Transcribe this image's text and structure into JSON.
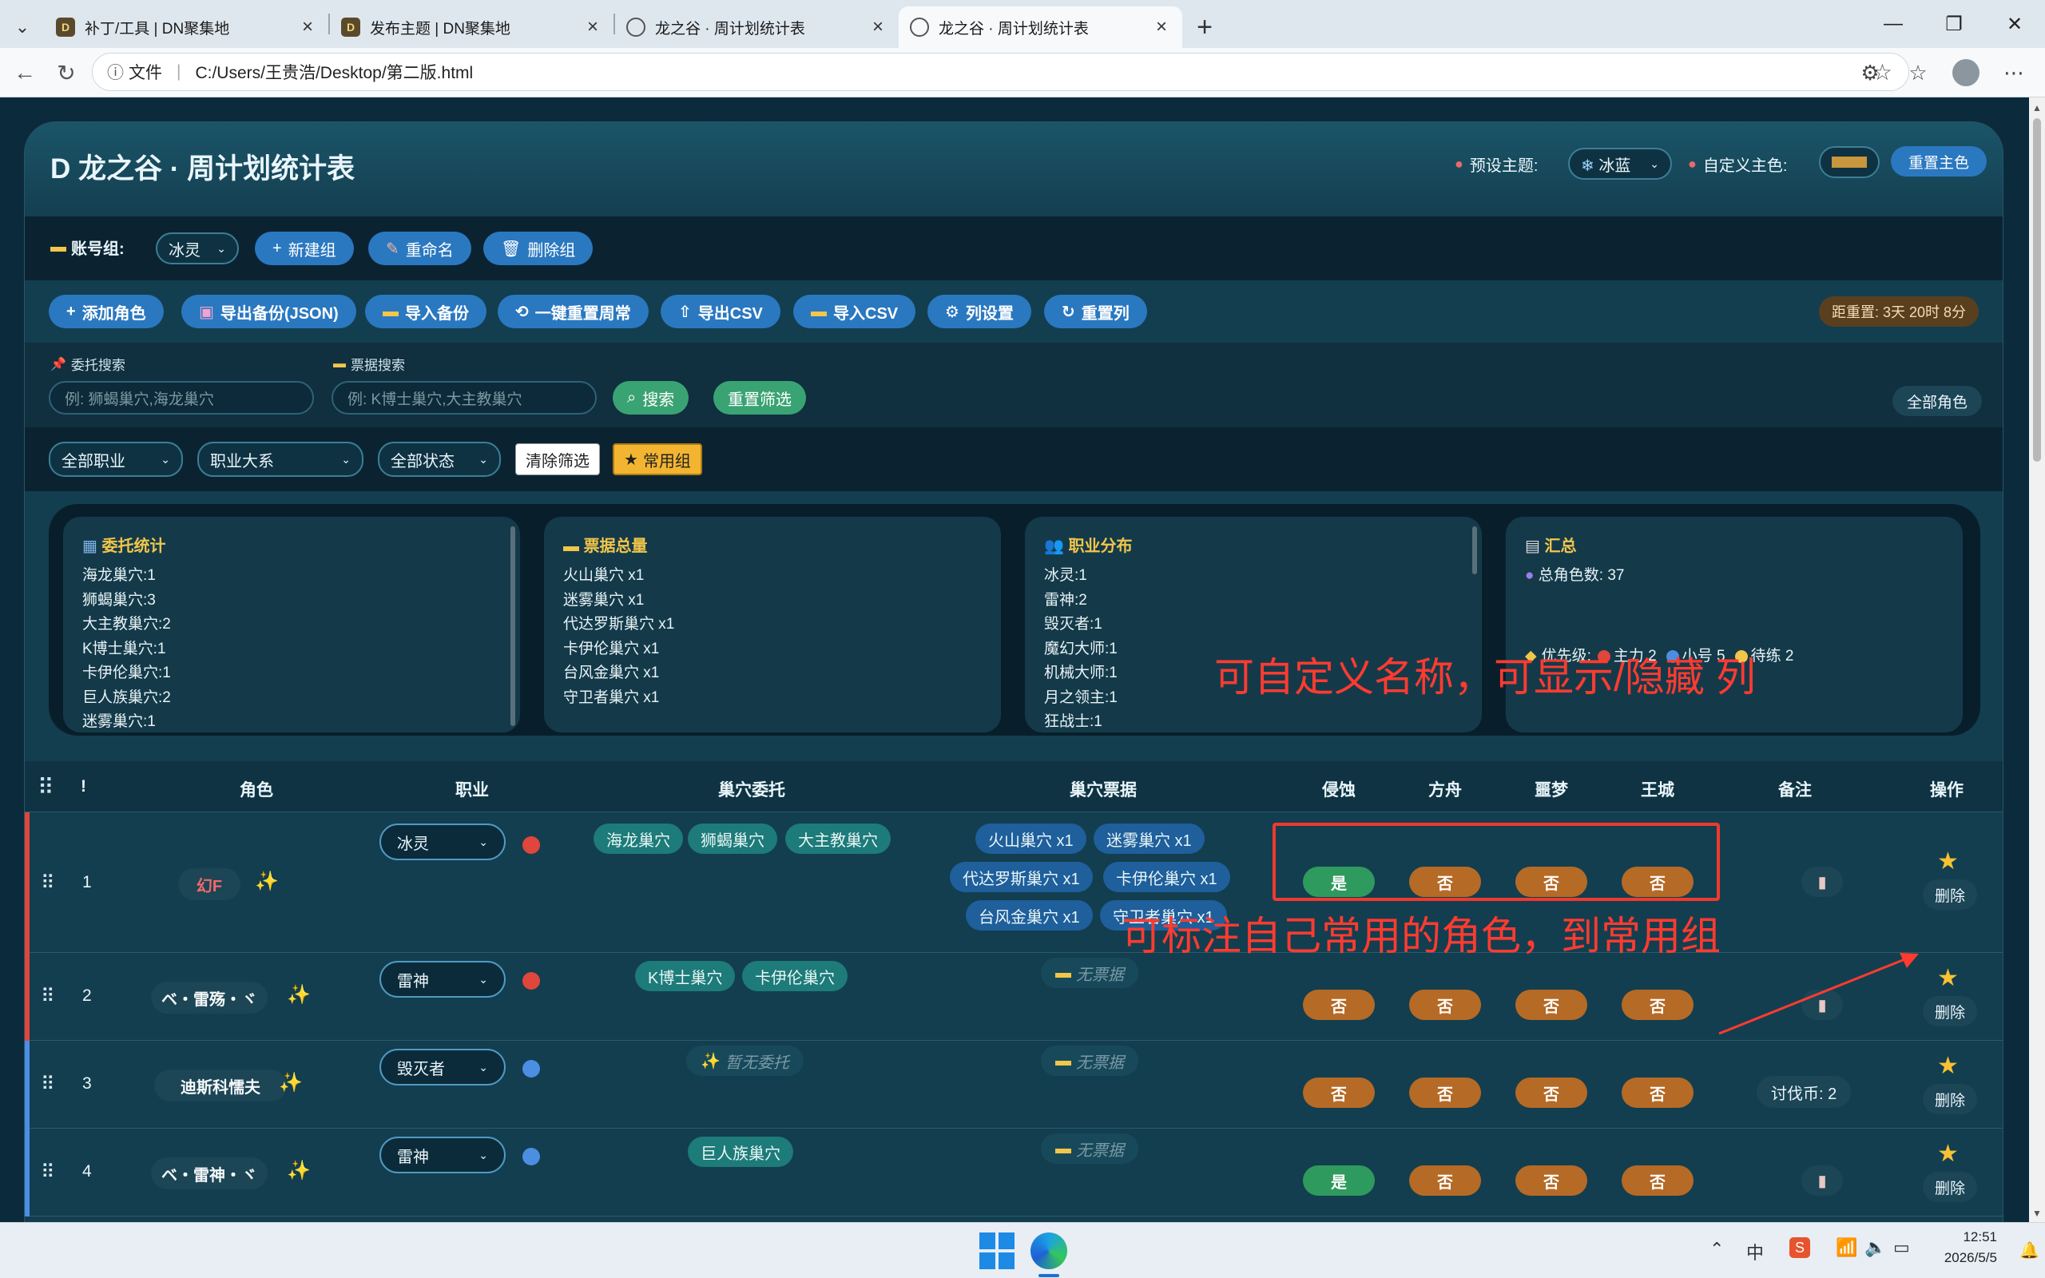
{
  "browser": {
    "tabs": [
      {
        "title": "补丁/工具 | DN聚集地",
        "favicon": "dn-logo-icon",
        "active": false
      },
      {
        "title": "发布主题 | DN聚集地",
        "favicon": "dn-logo-icon",
        "active": false
      },
      {
        "title": "龙之谷 · 周计划统计表",
        "favicon": "globe-icon",
        "active": false
      },
      {
        "title": "龙之谷 · 周计划统计表",
        "favicon": "globe-icon",
        "active": true
      }
    ],
    "address": {
      "info": "文件",
      "url": "C:/Users/王贵浩/Desktop/第二版.html"
    }
  },
  "header": {
    "title": "D 龙之谷 · 周计划统计表",
    "preset_theme_label": "预设主题:",
    "preset_theme_value": "冰蓝",
    "custom_color_label": "自定义主色:",
    "custom_color": "#c8963c",
    "reset_color": "重置主色"
  },
  "groupbar": {
    "label": "账号组:",
    "selected": "冰灵",
    "new": "新建组",
    "rename": "重命名",
    "delete": "删除组"
  },
  "actions": {
    "add_role": "添加角色",
    "export_json": "导出备份(JSON)",
    "import_backup": "导入备份",
    "reset_weekly": "一键重置周常",
    "export_csv": "导出CSV",
    "import_csv": "导入CSV",
    "col_settings": "列设置",
    "reset_cols": "重置列",
    "countdown": "距重置: 3天 20时 8分"
  },
  "search": {
    "commission_label": "委托搜索",
    "commission_placeholder": "例: 狮蝎巢穴,海龙巢穴",
    "ticket_label": "票据搜索",
    "ticket_placeholder": "例: K博士巢穴,大主教巢穴",
    "search_btn": "搜索",
    "reset_btn": "重置筛选",
    "all_roles": "全部角色"
  },
  "filters": {
    "job": "全部职业",
    "job_class": "职业大系",
    "status": "全部状态",
    "clear": "清除筛选",
    "favorites": "常用组"
  },
  "stats": {
    "commission": {
      "title": "委托统计",
      "lines": [
        "海龙巢穴:1",
        "狮蝎巢穴:3",
        "大主教巢穴:2",
        "K博士巢穴:1",
        "卡伊伦巢穴:1",
        "巨人族巢穴:2",
        "迷雾巢穴:1"
      ]
    },
    "tickets": {
      "title": "票据总量",
      "lines": [
        "火山巢穴 x1",
        "迷雾巢穴 x1",
        "代达罗斯巢穴 x1",
        "卡伊伦巢穴 x1",
        "台风金巢穴 x1",
        "守卫者巢穴 x1"
      ]
    },
    "jobs": {
      "title": "职业分布",
      "lines": [
        "冰灵:1",
        "雷神:2",
        "毁灭者:1",
        "魔幻大师:1",
        "机械大师:1",
        "月之领主:1",
        "狂战士:1"
      ]
    },
    "summary": {
      "title": "汇总",
      "total": "总角色数: 37",
      "priority_label": "优先级:",
      "p1": "主力 2",
      "p2": "小号 5",
      "p3": "待练 2"
    }
  },
  "table": {
    "headers": [
      "!",
      "角色",
      "职业",
      "巢穴委托",
      "巢穴票据",
      "侵蚀",
      "方舟",
      "噩梦",
      "王城",
      "备注",
      "操作"
    ],
    "rows": [
      {
        "num": "1",
        "name": "幻F",
        "job": "冰灵",
        "priority": "red",
        "commissions": [
          "海龙巢穴",
          "狮蝎巢穴",
          "大主教巢穴"
        ],
        "tickets": [
          "火山巢穴 x1",
          "迷雾巢穴 x1",
          "代达罗斯巢穴 x1",
          "卡伊伦巢穴 x1",
          "台风金巢穴 x1",
          "守卫者巢穴 x1"
        ],
        "flags": [
          "是",
          "否",
          "否",
          "否"
        ],
        "note": "",
        "delete": "删除"
      },
      {
        "num": "2",
        "name": "ベ・雷殇・ヾ",
        "job": "雷神",
        "priority": "red",
        "commissions": [
          "K博士巢穴",
          "卡伊伦巢穴"
        ],
        "tickets_empty": "无票据",
        "flags": [
          "否",
          "否",
          "否",
          "否"
        ],
        "note": "",
        "delete": "删除"
      },
      {
        "num": "3",
        "name": "迪斯科懦夫",
        "job": "毁灭者",
        "priority": "blue",
        "commissions_empty": "暂无委托",
        "tickets_empty": "无票据",
        "flags": [
          "否",
          "否",
          "否",
          "否"
        ],
        "note": "讨伐币: 2",
        "delete": "删除"
      },
      {
        "num": "4",
        "name": "ベ・雷神・ヾ",
        "job": "雷神",
        "priority": "blue",
        "commissions": [
          "巨人族巢穴"
        ],
        "tickets_empty": "无票据",
        "flags": [
          "是",
          "否",
          "否",
          "否"
        ],
        "note": "",
        "delete": "删除"
      }
    ]
  },
  "annotations": {
    "columns_note": "可自定义名称，可显示/隐藏 列",
    "favorites_note": "可标注自己常用的角色，到常用组"
  },
  "taskbar": {
    "time": "12:51",
    "date": "2026/5/5",
    "ime": "中"
  },
  "colors": {
    "accent": "#2a78c0",
    "yes": "#2f9a5d",
    "no": "#b56a26",
    "red_priority": "#e0463b",
    "blue_priority": "#4b8ee2",
    "annotation": "#ff3b30"
  }
}
